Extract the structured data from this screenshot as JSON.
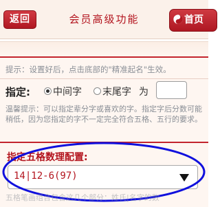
{
  "header": {
    "back_label": "返回",
    "title": "会员高级功能",
    "home_label": "首页"
  },
  "tip": "提示：设置好后，点击底部的\"精准起名\"生效。",
  "specify": {
    "label": "指定:",
    "options": [
      "中间字",
      "末尾字"
    ],
    "selected": "中间字",
    "suffix": "为",
    "input_value": ""
  },
  "note": "温馨提示：可以指定辈分字或喜欢的字。指定字后分数可能稍低，因为您指定的字不一定完全符合五格、五行的要求。",
  "wuge": {
    "section_title": "指定五格数理配置:",
    "selected_value": "14|12-6(97)"
  },
  "footer_text": "五格笔画组合包含这几个部分：姓氏|名字的数",
  "colors": {
    "brand_red": "#b3141e",
    "highlight_blue": "#1010dd"
  }
}
